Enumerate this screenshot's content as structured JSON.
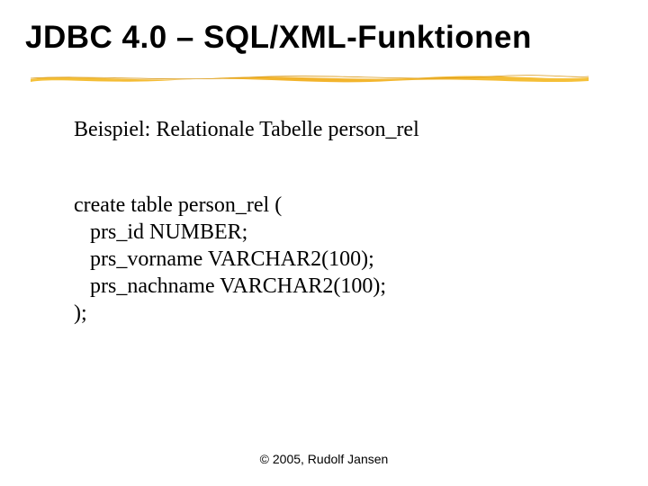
{
  "title": "JDBC 4.0 – SQL/XML-Funktionen",
  "subtitle": "Beispiel: Relationale Tabelle person_rel",
  "code": {
    "l1": "create table person_rel (",
    "l2": "prs_id NUMBER;",
    "l3": "prs_vorname VARCHAR2(100);",
    "l4": "prs_nachname VARCHAR2(100);",
    "l5": ");"
  },
  "footer": "© 2005, Rudolf Jansen"
}
